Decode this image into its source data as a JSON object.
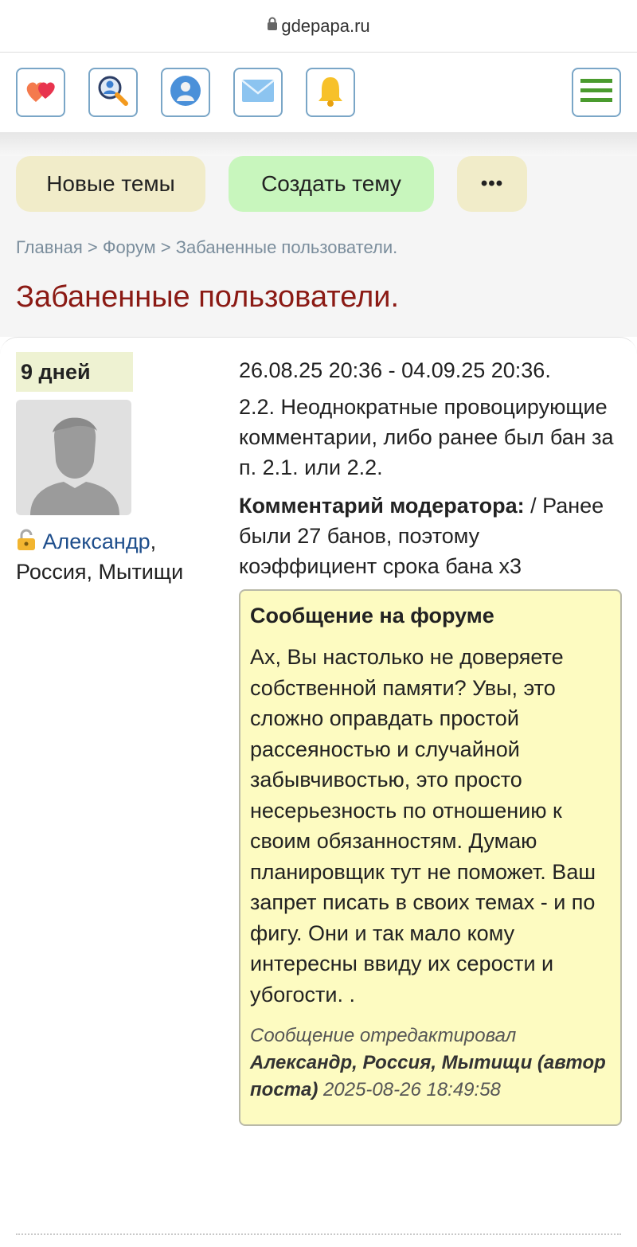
{
  "browser": {
    "url": "gdepapa.ru"
  },
  "iconbar": {
    "icons": [
      "hearts-icon",
      "search-user-icon",
      "profile-icon",
      "mail-icon",
      "bell-icon"
    ],
    "menu_icon": "hamburger-menu-icon"
  },
  "actions": {
    "new_topics": "Новые темы",
    "create_topic": "Создать тему",
    "more": "•••"
  },
  "breadcrumb": {
    "home": "Главная",
    "sep1": " > ",
    "forum": "Форум",
    "sep2": " > ",
    "current": "Забаненные пользователи."
  },
  "page": {
    "title": "Забаненные пользователи."
  },
  "ban": {
    "duration": "9 дней",
    "user_name": "Александр",
    "user_suffix": ",",
    "user_location": "Россия, Мытищи",
    "period": "26.08.25 20:36 - 04.09.25 20:36.",
    "reason": "2.2. Неоднократные провоцирующие комментарии, либо ранее был бан за п. 2.1. или 2.2.",
    "moderator_label": "Комментарий модератора:",
    "moderator_text": " / Ранее были 27 банов, поэтому коэффициент срока бана х3",
    "forum_post": {
      "title": "Сообщение на форуме",
      "text": "Ах, Вы настолько не доверяете собственной памяти? Увы, это сложно оправдать простой рассеяностью и случайной забывчивостью, это просто несерьезность по отношению к своим обязанностям. Думаю планировщик тут не поможет. Ваш запрет писать в своих темах - и по фигу. Они и так мало кому интересны ввиду их серости и убогости. .",
      "edited_prefix": "Сообщение отредактировал",
      "edited_by": "Александр, Россия, Мытищи (автор поста)",
      "edited_at": " 2025-08-26 18:49:58"
    }
  },
  "colors": {
    "title": "#8b1a14",
    "link": "#1e4e8c",
    "forum_box_bg": "#fdfbc1",
    "create_btn": "#c8f6bd",
    "new_btn": "#f1ecc9"
  }
}
